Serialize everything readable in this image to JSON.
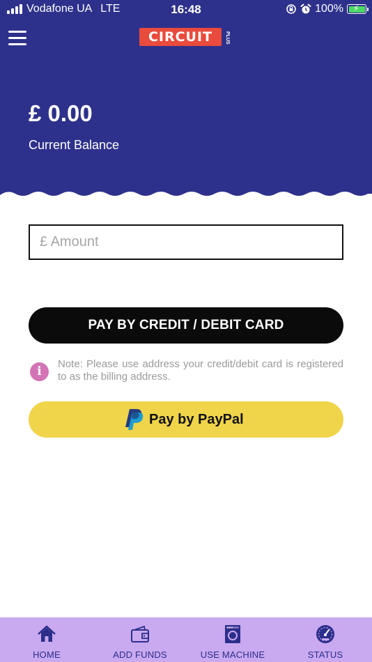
{
  "status_bar": {
    "carrier": "Vodafone UA",
    "network": "LTE",
    "time": "16:48",
    "battery": "100%"
  },
  "header": {
    "logo_text": "CIRCUIT",
    "logo_plus": "PLUS",
    "menu_icon": "hamburger-menu-icon"
  },
  "balance": {
    "amount": "£ 0.00",
    "label": "Current Balance"
  },
  "form": {
    "amount_placeholder": "£ Amount",
    "amount_value": "",
    "card_button_label": "PAY BY CREDIT / DEBIT CARD",
    "note_icon": "info-icon",
    "note_text": "Note: Please use address your credit/debit card is registered to as the billing address.",
    "paypal_button_label": "Pay by PayPal"
  },
  "tabs": [
    {
      "label": "HOME",
      "icon": "home-icon"
    },
    {
      "label": "ADD FUNDS",
      "icon": "wallet-icon"
    },
    {
      "label": "USE MACHINE",
      "icon": "washing-machine-icon"
    },
    {
      "label": "STATUS",
      "icon": "gauge-icon"
    }
  ],
  "colors": {
    "hero": "#2e318b",
    "tabbar": "#c9a9f0",
    "paypal_button": "#f0d44a",
    "logo": "#e94b3c",
    "info_icon": "#d374b5"
  }
}
